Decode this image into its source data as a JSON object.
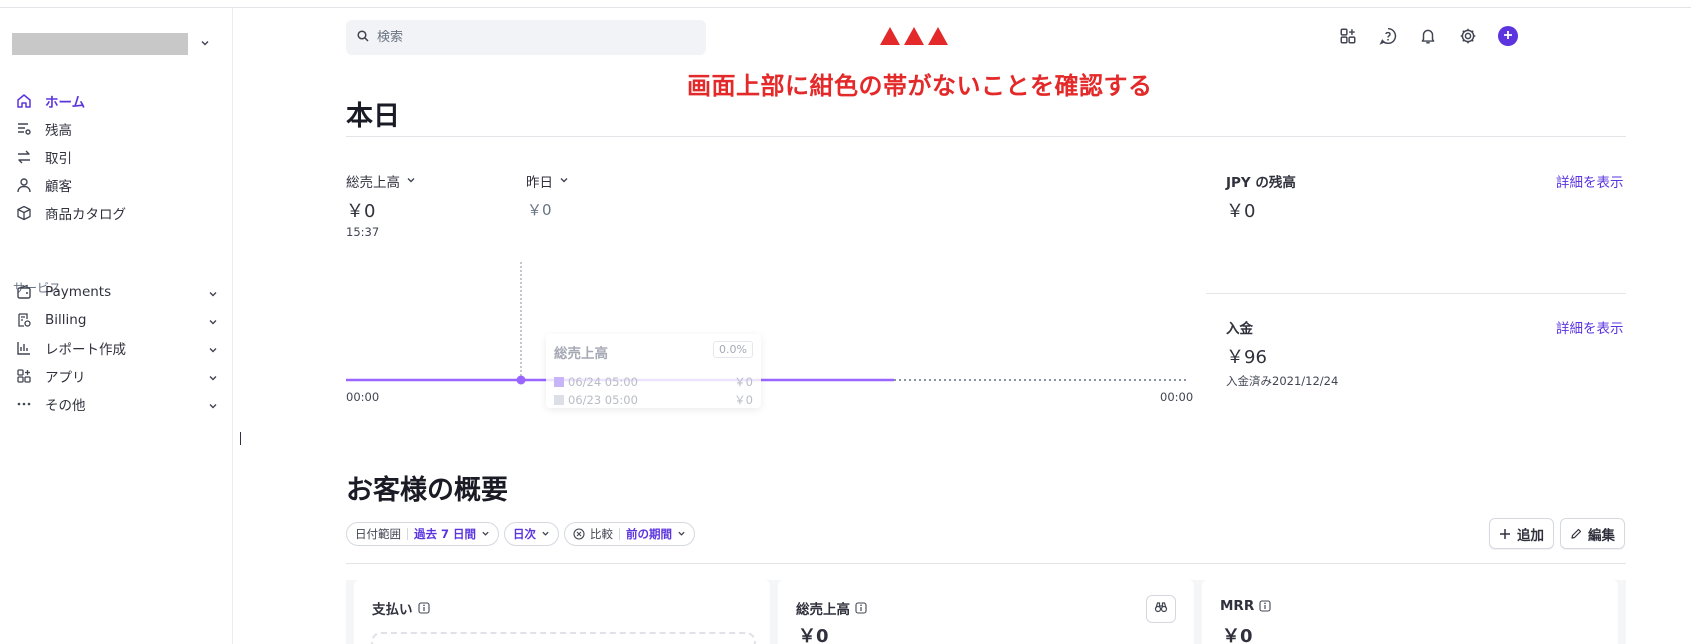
{
  "sidebar": {
    "nav": [
      {
        "label": "ホーム",
        "icon": "home-icon"
      },
      {
        "label": "残高",
        "icon": "balance-icon"
      },
      {
        "label": "取引",
        "icon": "transactions-icon"
      },
      {
        "label": "顧客",
        "icon": "customer-icon"
      },
      {
        "label": "商品カタログ",
        "icon": "product-catalog-icon"
      }
    ],
    "services_heading": "サービス",
    "services": [
      {
        "label": "Payments",
        "icon": "wallet-icon"
      },
      {
        "label": "Billing",
        "icon": "billing-icon"
      },
      {
        "label": "レポート作成",
        "icon": "bar-chart-icon"
      },
      {
        "label": "アプリ",
        "icon": "apps-icon"
      },
      {
        "label": "その他",
        "icon": "more-icon"
      }
    ]
  },
  "header": {
    "search_placeholder": "検索",
    "icons": [
      "apps-grid-icon",
      "help-icon",
      "bell-icon",
      "gear-icon",
      "plus-icon"
    ]
  },
  "annotation": {
    "text": "画面上部に紺色の帯がないことを確認する",
    "color": "#e32929"
  },
  "today": {
    "title": "本日",
    "gross_label": "総売上高",
    "gross_value": "￥0",
    "gross_time": "15:37",
    "compare_label": "昨日",
    "compare_value": "￥0",
    "axis_start": "00:00",
    "axis_end": "00:00",
    "tooltip": {
      "title": "総売上高",
      "pct": "0.0%",
      "rows": [
        {
          "label": "06/24 05:00",
          "value": "￥0"
        },
        {
          "label": "06/23 05:00",
          "value": "￥0"
        }
      ]
    },
    "balance_label": "JPY の残高",
    "balance_value": "￥0",
    "payout_label": "入金",
    "payout_value": "￥96",
    "payout_note": "入金済み2021/12/24",
    "details_link": "詳細を表示"
  },
  "chart_data": {
    "type": "line",
    "title": "",
    "xlabel": "",
    "ylabel": "",
    "x_ticks": [
      "00:00",
      "00:00"
    ],
    "series": [
      {
        "name": "総売上高",
        "values": [
          0,
          0
        ],
        "color": "#9966ff"
      }
    ]
  },
  "overview": {
    "title": "お客様の概要",
    "filters": [
      {
        "key": "日付範囲",
        "value": "過去 7 日間"
      },
      {
        "key": "",
        "value": "日次"
      },
      {
        "key": "比較",
        "value": "前の期間"
      }
    ],
    "add_label": "追加",
    "edit_label": "編集",
    "cards": [
      {
        "title": "支払い",
        "value": ""
      },
      {
        "title": "総売上高",
        "value": "￥0"
      },
      {
        "title": "MRR",
        "value": "￥0"
      }
    ]
  },
  "colors": {
    "accent": "#5b34e0",
    "chart_line": "#9966ff"
  }
}
